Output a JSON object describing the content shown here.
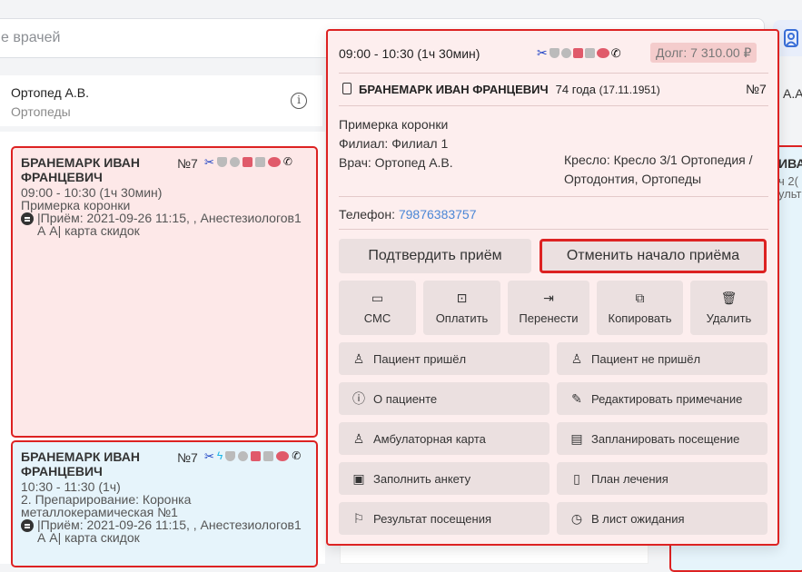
{
  "search": {
    "placeholder": "е врачей"
  },
  "doctor": {
    "name": "Ортопед А.В.",
    "specialty": "Ортопеды"
  },
  "appointments": [
    {
      "patient": "БРАНЕМАРК ИВАН ФРАНЦЕВИЧ",
      "num": "№7",
      "time": "09:00 - 10:30 (1ч 30мин)",
      "procedure": "Примерка коронки",
      "comment": "|Приём: 2021-09-26 11:15, , Анестезиологов1 А А| карта скидок"
    },
    {
      "patient": "БРАНЕМАРК ИВАН ФРАНЦЕВИЧ",
      "num": "№7",
      "time": "10:30 - 11:30 (1ч)",
      "procedure": "2. Препарирование: Коронка металлокерамическая №1",
      "comment": "|Приём: 2021-09-26 11:15, , Анестезиологов1 А А| карта скидок"
    }
  ],
  "right_column": {
    "a": "А.А",
    "b": "ИВА",
    "c": "ч 2(",
    "d": "ульт"
  },
  "popup": {
    "time": "09:00 - 10:30 (1ч 30мин)",
    "debt": "Долг: 7 310.00 ₽",
    "patient_name": "БРАНЕМАРК ИВАН ФРАНЦЕВИЧ",
    "age": "74 года",
    "birth": "(17.11.1951)",
    "num": "№7",
    "procedure": "Примерка коронки",
    "branch": "Филиал: Филиал 1",
    "doctor": "Врач: Ортопед А.В.",
    "chair": "Кресло: Кресло 3/1 Ортопедия / Ортодонтия, Ортопеды",
    "phone_label": "Телефон:",
    "phone": "79876383757",
    "confirm_label": "Подтвердить приём",
    "cancel_label": "Отменить начало приёма",
    "actions": [
      {
        "label": "СМС",
        "icon": "message-icon"
      },
      {
        "label": "Оплатить",
        "icon": "payment-icon"
      },
      {
        "label": "Перенести",
        "icon": "move-icon"
      },
      {
        "label": "Копировать",
        "icon": "copy-icon"
      },
      {
        "label": "Удалить",
        "icon": "trash-icon"
      }
    ],
    "menu": [
      {
        "label": "Пациент пришёл",
        "icon": "user-check-icon"
      },
      {
        "label": "Пациент не пришёл",
        "icon": "user-x-icon"
      },
      {
        "label": "О пациенте",
        "icon": "info-icon"
      },
      {
        "label": "Редактировать примечание",
        "icon": "edit-icon"
      },
      {
        "label": "Амбулаторная карта",
        "icon": "user-list-icon"
      },
      {
        "label": "Запланировать посещение",
        "icon": "calendar-icon"
      },
      {
        "label": "Заполнить анкету",
        "icon": "clipboard-icon"
      },
      {
        "label": "План лечения",
        "icon": "document-icon"
      },
      {
        "label": "Результат посещения",
        "icon": "flag-icon"
      },
      {
        "label": "В лист ожидания",
        "icon": "clock-plus-icon"
      }
    ]
  },
  "colors": {
    "accent_red": "#dd2222",
    "card_pink": "#fde8e8",
    "card_blue": "#e6f4fb",
    "link": "#4a86d6"
  }
}
